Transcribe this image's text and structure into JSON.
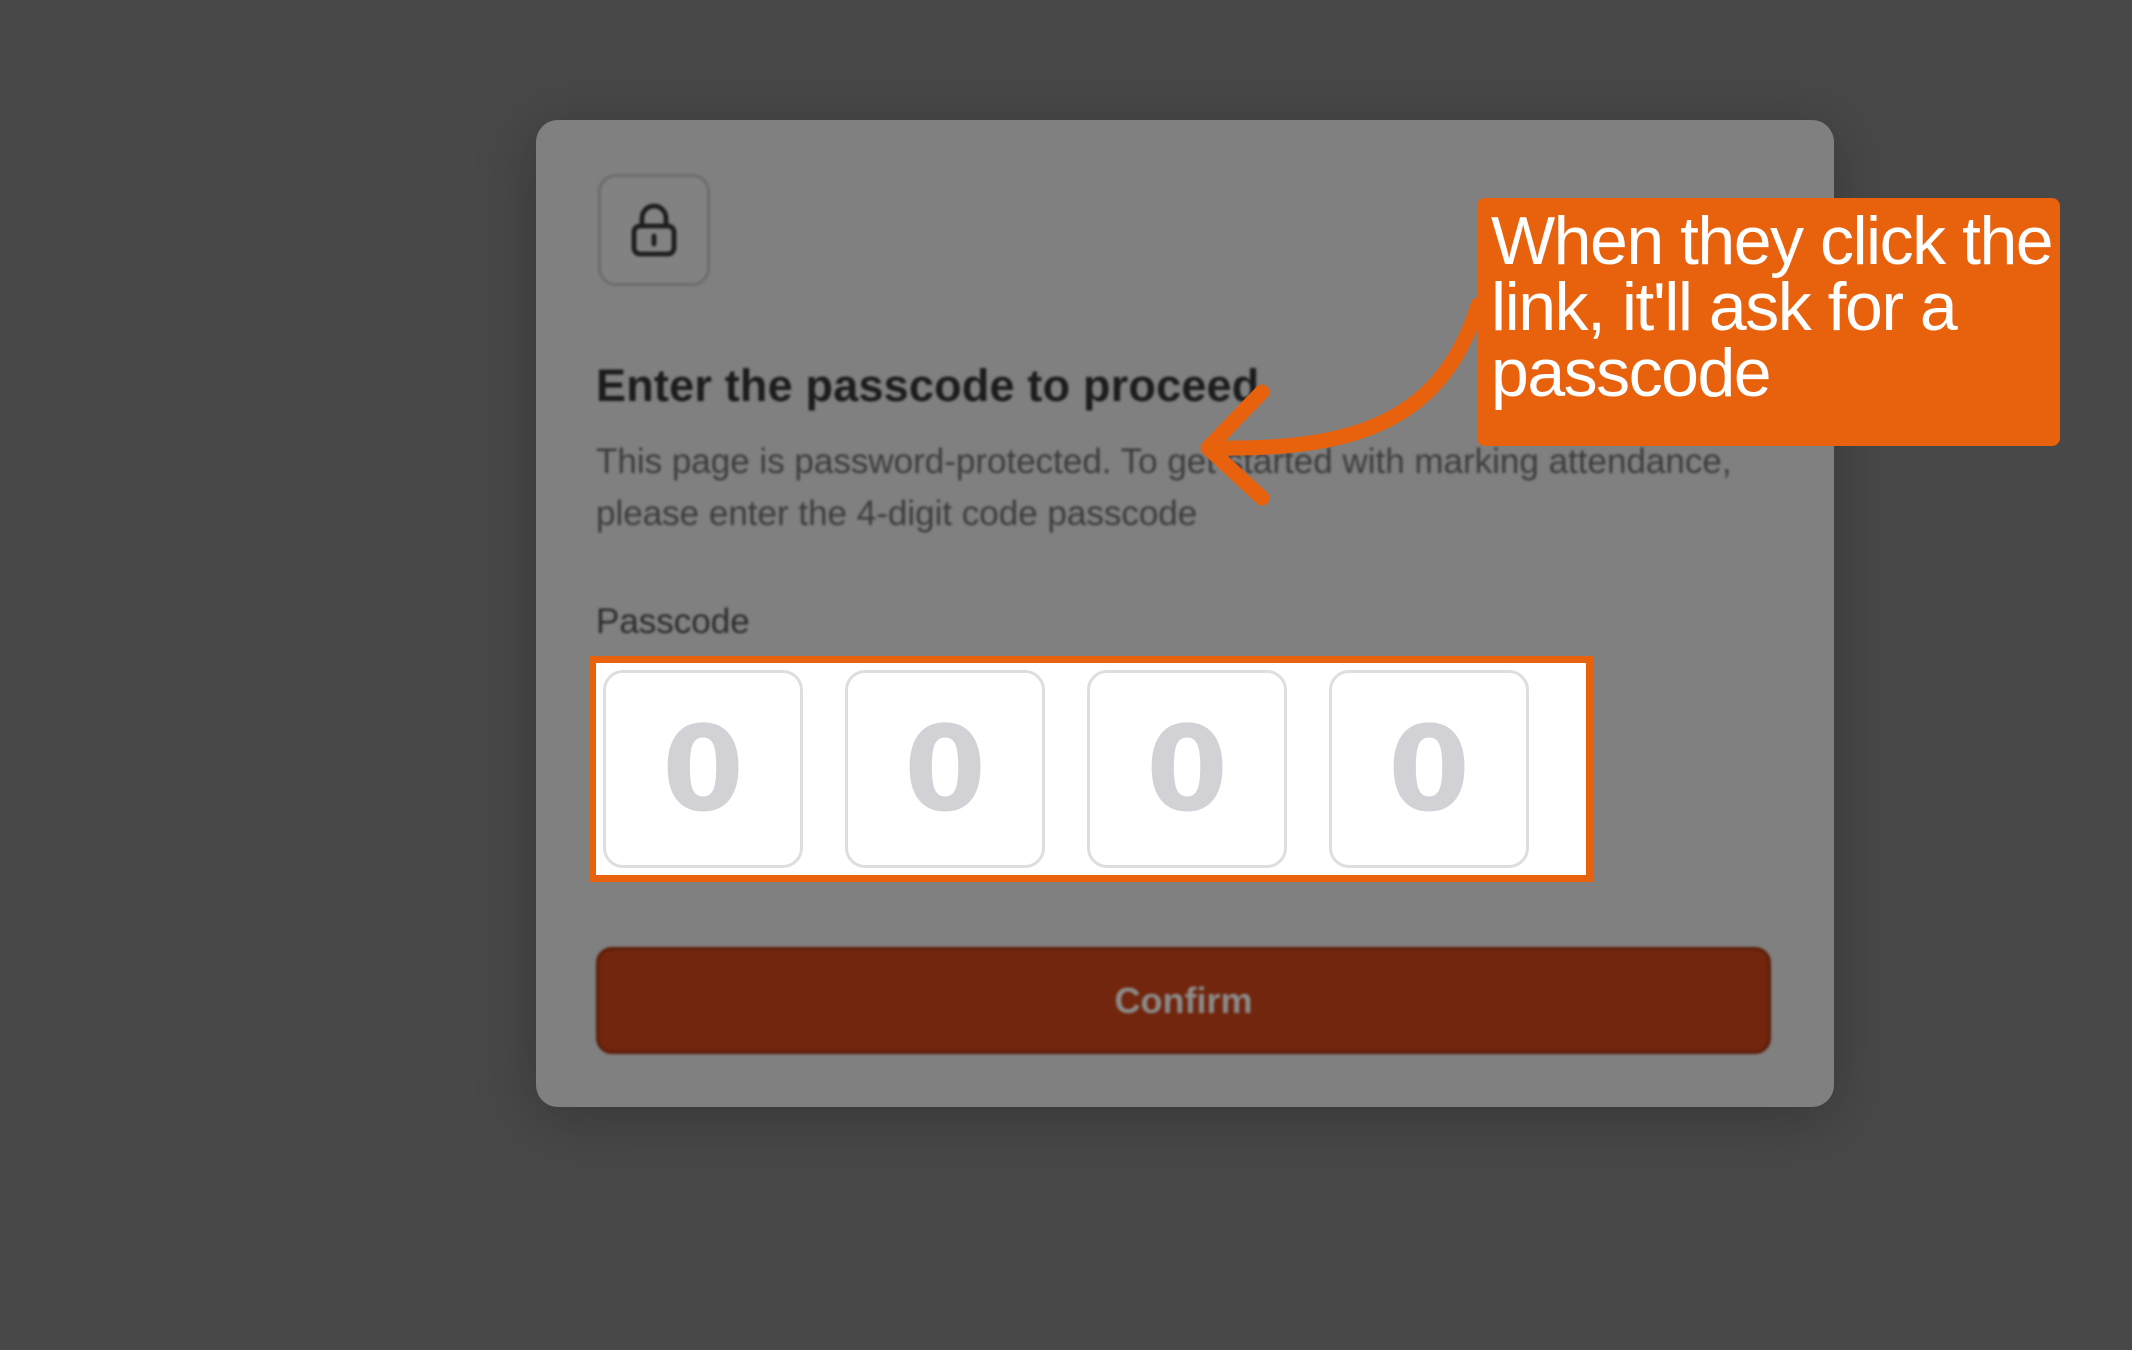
{
  "modal": {
    "title": "Enter the passcode to proceed",
    "description": "This page is password-protected. To get started with marking attendance, please enter the 4-digit code passcode",
    "passcode_label": "Passcode",
    "otp_placeholders": [
      "0",
      "0",
      "0",
      "0"
    ],
    "confirm_label": "Confirm"
  },
  "annotation": {
    "text": "When they click the link, it'll ask for a passcode"
  },
  "icons": {
    "lock": "lock-icon",
    "arrow": "curved-arrow-icon"
  },
  "colors": {
    "background": "#484848",
    "modal": "#808080",
    "accent": "#e8610c",
    "confirm": "#71260d"
  }
}
